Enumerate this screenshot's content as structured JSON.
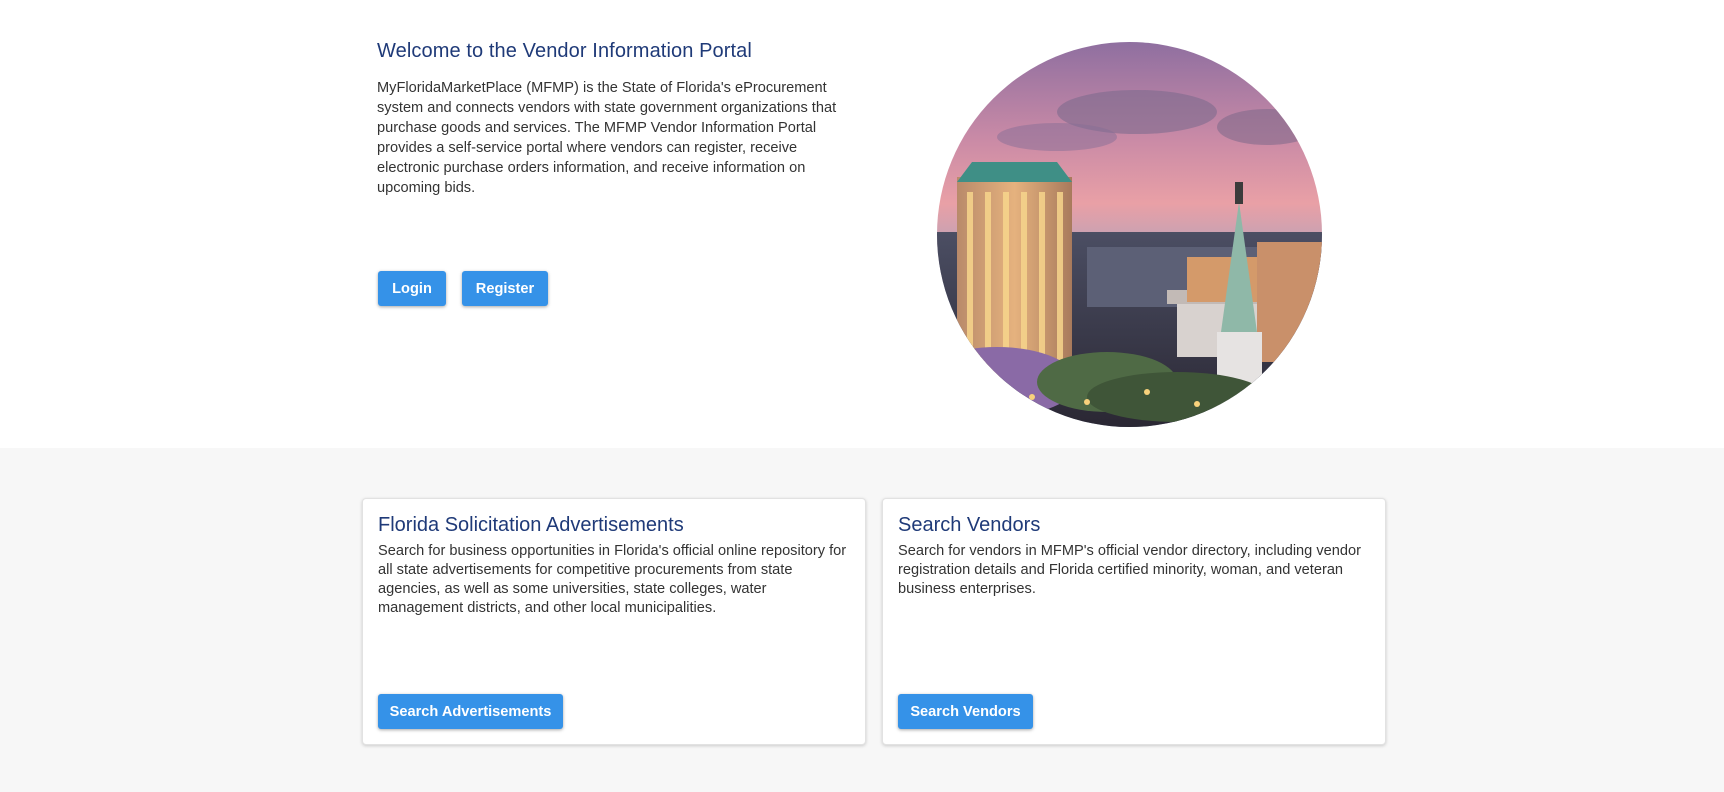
{
  "hero": {
    "title": "Welcome to the Vendor Information Portal",
    "description": "MyFloridaMarketPlace (MFMP) is the State of Florida's eProcurement system and connects vendors with state government organizations that purchase goods and services. The MFMP Vendor Information Portal provides a self-service portal where vendors can register, receive electronic purchase orders information, and receive information on upcoming bids.",
    "login_label": "Login",
    "register_label": "Register",
    "image_description": "Tallahassee skyline at dusk"
  },
  "cards": [
    {
      "title": "Florida Solicitation Advertisements",
      "description": "Search for business opportunities in Florida's official online repository for all state advertisements for competitive procurements from state agencies, as well as some universities, state colleges, water management districts, and other local municipalities.",
      "button_label": "Search Advertisements"
    },
    {
      "title": "Search Vendors",
      "description": "Search for vendors in MFMP's official vendor directory, including vendor registration details and Florida certified minority, woman, and veteran business enterprises.",
      "button_label": "Search Vendors"
    }
  ],
  "colors": {
    "heading": "#1f3a78",
    "button": "#3592e8",
    "lower_background": "#f7f7f7"
  }
}
